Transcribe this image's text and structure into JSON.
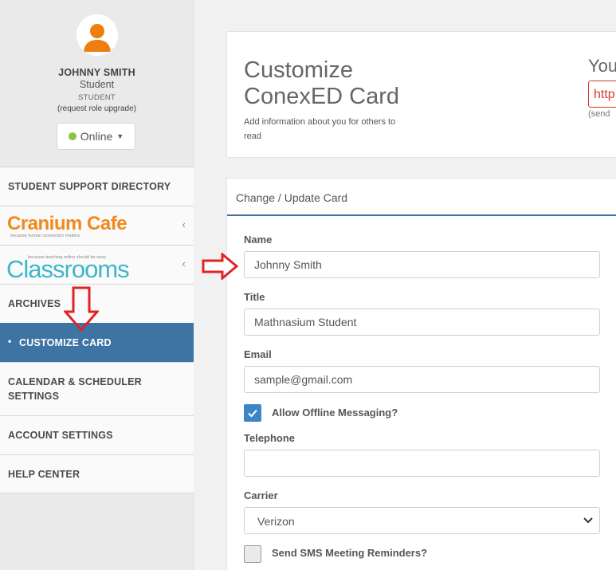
{
  "profile": {
    "name": "JOHNNY SMITH",
    "role": "Student",
    "role_small": "STUDENT",
    "role_upgrade": "(request role upgrade)",
    "status": "Online",
    "status_color": "#8bc34a"
  },
  "nav": {
    "support_directory": "STUDENT SUPPORT DIRECTORY",
    "cranium_logo": "Cranium Cafe",
    "cranium_tagline": "because human connection matters",
    "classrooms_logo": "Classrooms",
    "classrooms_tagline": "because teaching online should be easy",
    "archives": "ARCHIVES",
    "customize_card": "CUSTOMIZE CARD",
    "calendar_line1": "CALENDAR & SCHEDULER",
    "calendar_line2": "SETTINGS",
    "account_settings": "ACCOUNT SETTINGS",
    "help_center": "HELP CENTER",
    "active_color": "#3d74a4"
  },
  "header_card": {
    "title_line1": "Customize",
    "title_line2": "ConexED Card",
    "subtitle_line1": "Add information about you for others to",
    "subtitle_line2": "read",
    "url_label": "You",
    "url_value": "http",
    "send_text": "(send"
  },
  "form": {
    "header": "Change / Update Card",
    "name_label": "Name",
    "name_value": "Johnny Smith",
    "title_label": "Title",
    "title_value": "Mathnasium Student",
    "email_label": "Email",
    "email_value": "sample@gmail.com",
    "offline_label": "Allow Offline Messaging?",
    "offline_checked": true,
    "telephone_label": "Telephone",
    "telephone_value": "",
    "carrier_label": "Carrier",
    "carrier_value": "Verizon",
    "sms_label": "Send SMS Meeting Reminders?",
    "sms_checked": false
  },
  "annotations": {
    "arrow_color": "#e02424"
  }
}
